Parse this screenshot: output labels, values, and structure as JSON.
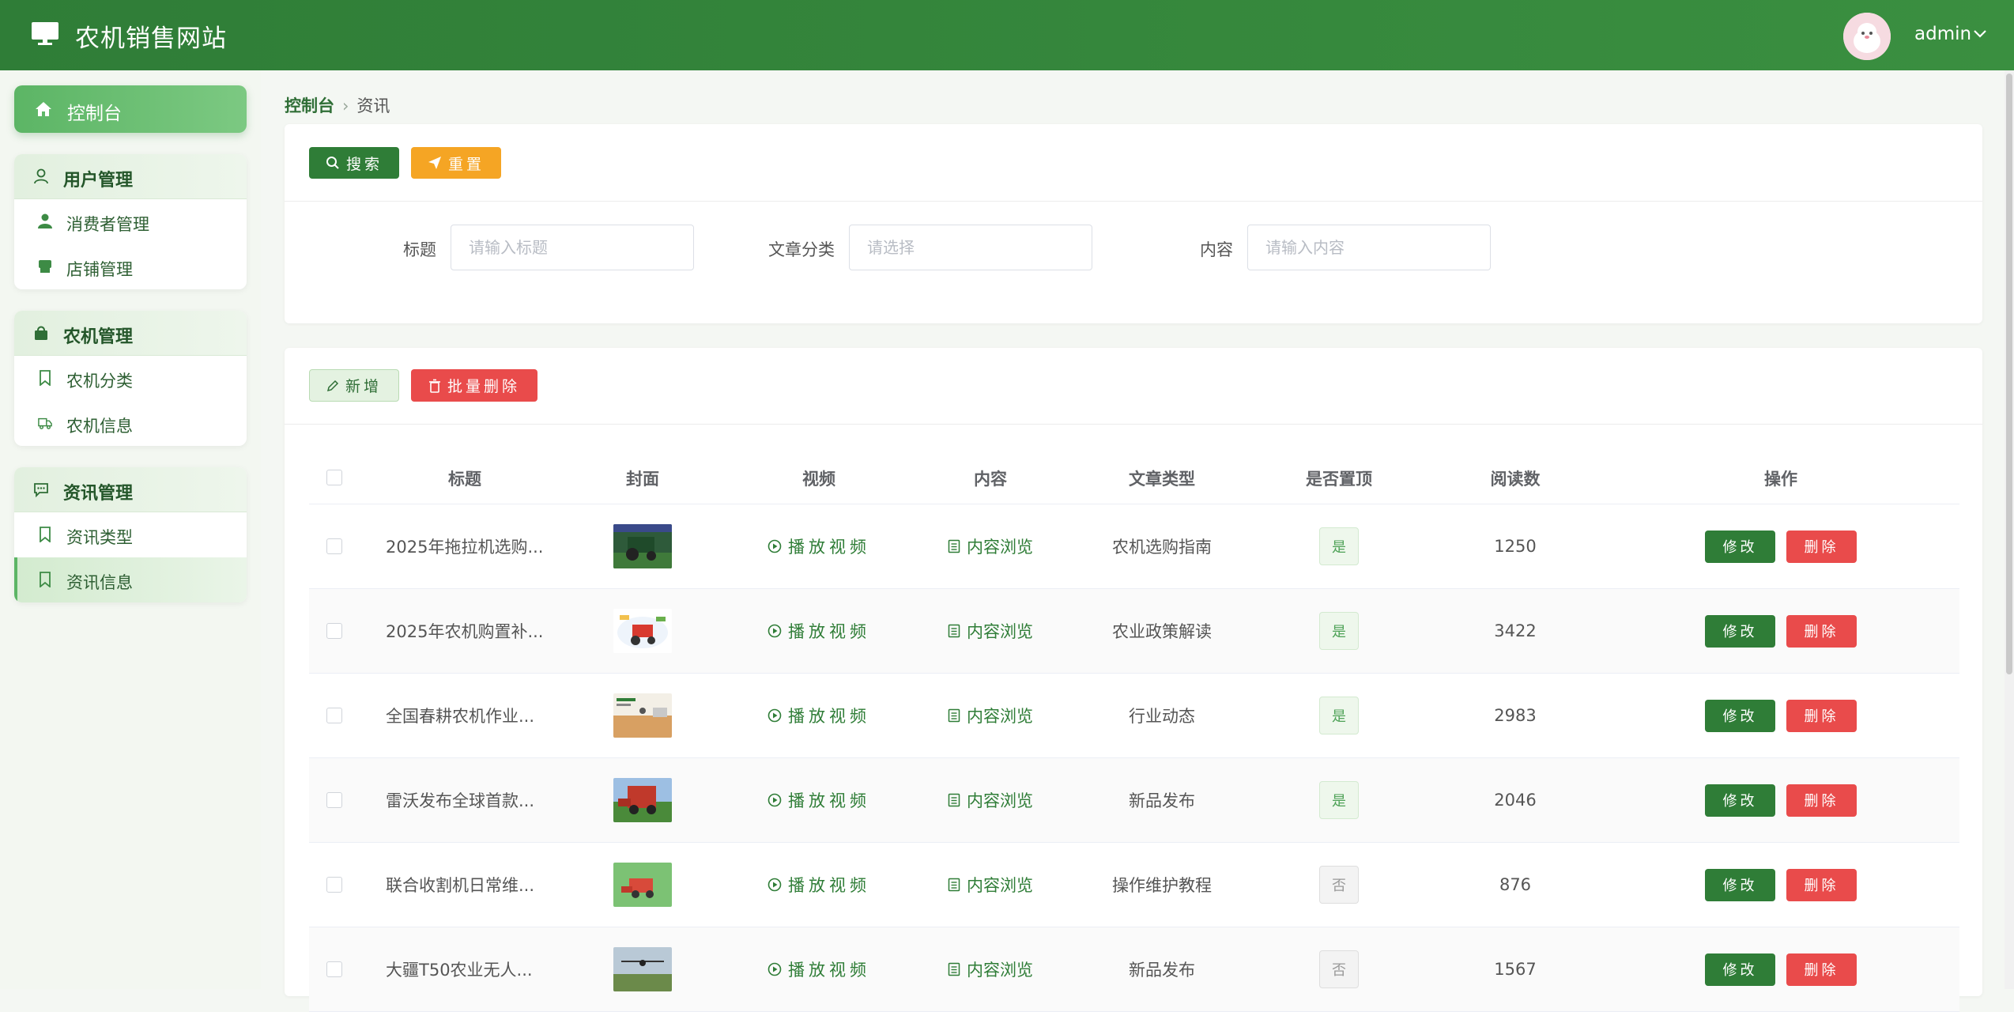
{
  "header": {
    "app_title": "农机销售网站",
    "username": "admin"
  },
  "sidebar": {
    "home": "控制台",
    "groups": [
      {
        "title": "用户管理",
        "items": [
          {
            "label": "消费者管理"
          },
          {
            "label": "店铺管理"
          }
        ]
      },
      {
        "title": "农机管理",
        "items": [
          {
            "label": "农机分类"
          },
          {
            "label": "农机信息"
          }
        ]
      },
      {
        "title": "资讯管理",
        "items": [
          {
            "label": "资讯类型"
          },
          {
            "label": "资讯信息",
            "active": true
          }
        ]
      }
    ]
  },
  "breadcrumb": {
    "root": "控制台",
    "current": "资讯"
  },
  "search": {
    "search_btn": "搜索",
    "reset_btn": "重置",
    "fields": [
      {
        "label": "标题",
        "placeholder": "请输入标题"
      },
      {
        "label": "文章分类",
        "placeholder": "请选择"
      },
      {
        "label": "内容",
        "placeholder": "请输入内容"
      }
    ]
  },
  "toolbar": {
    "add_btn": "新增",
    "batch_delete_btn": "批量删除"
  },
  "table": {
    "columns": [
      "标题",
      "封面",
      "视频",
      "内容",
      "文章类型",
      "是否置顶",
      "阅读数",
      "操作"
    ],
    "video_link": "播放视频",
    "content_link": "内容浏览",
    "edit_btn": "修改",
    "delete_btn": "删除",
    "rows": [
      {
        "title": "2025年拖拉机选购...",
        "type": "农机选购指南",
        "top": "是",
        "reads": "1250"
      },
      {
        "title": "2025年农机购置补...",
        "type": "农业政策解读",
        "top": "是",
        "reads": "3422"
      },
      {
        "title": "全国春耕农机作业...",
        "type": "行业动态",
        "top": "是",
        "reads": "2983"
      },
      {
        "title": "雷沃发布全球首款...",
        "type": "新品发布",
        "top": "是",
        "reads": "2046"
      },
      {
        "title": "联合收割机日常维...",
        "type": "操作维护教程",
        "top": "否",
        "reads": "876"
      },
      {
        "title": "大疆T50农业无人...",
        "type": "新品发布",
        "top": "否",
        "reads": "1567"
      }
    ]
  },
  "colors": {
    "primary": "#2f7d37",
    "danger": "#e94b4b",
    "warning": "#f5a524"
  }
}
